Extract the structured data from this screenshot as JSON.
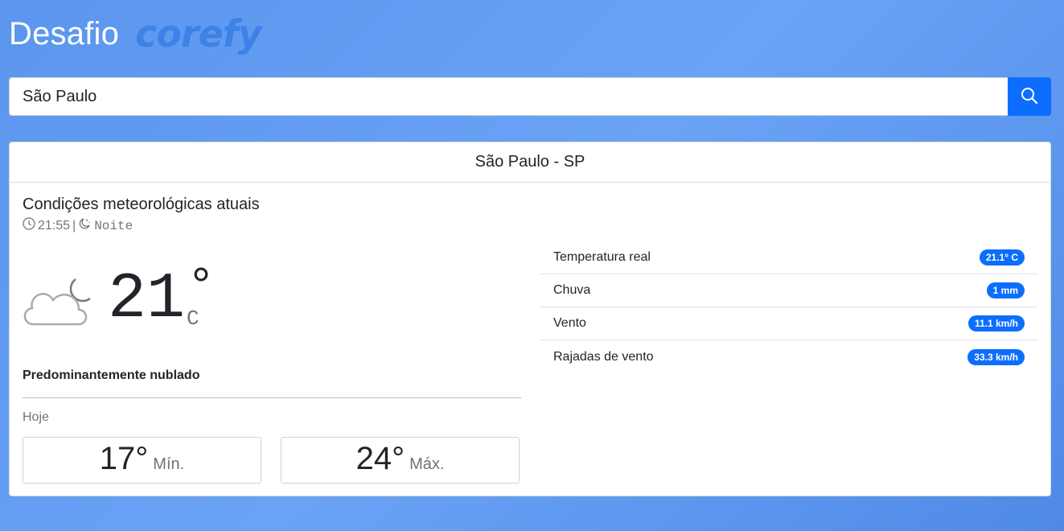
{
  "header": {
    "title": "Desafio",
    "logo": "corefy"
  },
  "search": {
    "value": "São Paulo",
    "placeholder": ""
  },
  "card": {
    "location": "São Paulo - SP",
    "conditions_title": "Condições meteorológicas atuais",
    "time": "21:55",
    "separator": "|",
    "period": "Noite",
    "temperature": "21",
    "degree_symbol": "°",
    "unit": "C",
    "description": "Predominantemente nublado",
    "today_label": "Hoje",
    "min": {
      "value": "17°",
      "label": "Mín."
    },
    "max": {
      "value": "24°",
      "label": "Máx."
    },
    "details": [
      {
        "label": "Temperatura real",
        "value": "21.1° C"
      },
      {
        "label": "Chuva",
        "value": "1 mm"
      },
      {
        "label": "Vento",
        "value": "11.1 km/h"
      },
      {
        "label": "Rajadas de vento",
        "value": "33.3 km/h"
      }
    ]
  },
  "icons": {
    "search": "search-icon",
    "clock": "clock-icon",
    "moon": "moon-stars-icon",
    "weather": "cloudy-night-icon"
  },
  "colors": {
    "primary": "#0d6efd",
    "background": "#5b95ee",
    "logo": "#3d82e6"
  }
}
